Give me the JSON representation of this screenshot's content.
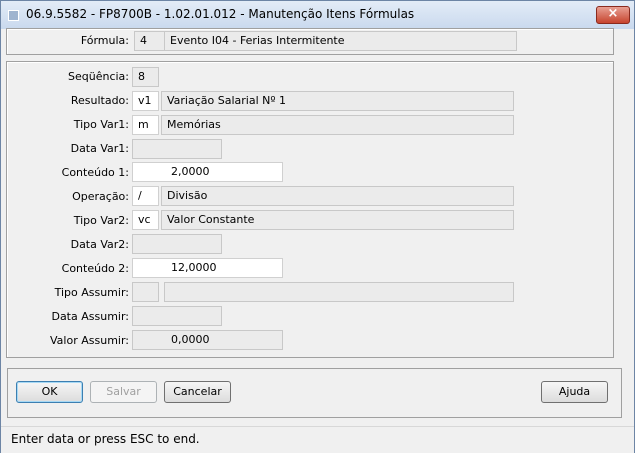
{
  "window": {
    "title": "06.9.5582 - FP8700B - 1.02.01.012 - Manutenção Itens Fórmulas",
    "close_symbol": "×"
  },
  "formula": {
    "label": "Fórmula:",
    "code": "4",
    "description": "Evento I04 - Ferias Intermitente"
  },
  "fields": {
    "sequencia": {
      "label": "Seqüência:",
      "value": "8"
    },
    "resultado": {
      "label": "Resultado:",
      "code": "v1",
      "description": "Variação Salarial Nº 1"
    },
    "tipo_var1": {
      "label": "Tipo Var1:",
      "code": "m",
      "description": "Memórias"
    },
    "data_var1": {
      "label": "Data Var1:",
      "value": ""
    },
    "conteudo1": {
      "label": "Conteúdo 1:",
      "value": "2,0000"
    },
    "operacao": {
      "label": "Operação:",
      "code": "/",
      "description": "Divisão"
    },
    "tipo_var2": {
      "label": "Tipo Var2:",
      "code": "vc",
      "description": "Valor Constante"
    },
    "data_var2": {
      "label": "Data Var2:",
      "value": ""
    },
    "conteudo2": {
      "label": "Conteúdo 2:",
      "value": "12,0000"
    },
    "tipo_assumir": {
      "label": "Tipo Assumir:",
      "code": "",
      "description": ""
    },
    "data_assumir": {
      "label": "Data Assumir:",
      "value": ""
    },
    "valor_assumir": {
      "label": "Valor Assumir:",
      "value": "0,0000"
    }
  },
  "buttons": {
    "ok": "OK",
    "salvar": "Salvar",
    "cancelar": "Cancelar",
    "ajuda": "Ajuda"
  },
  "status": {
    "text": "Enter data or press ESC to end."
  }
}
